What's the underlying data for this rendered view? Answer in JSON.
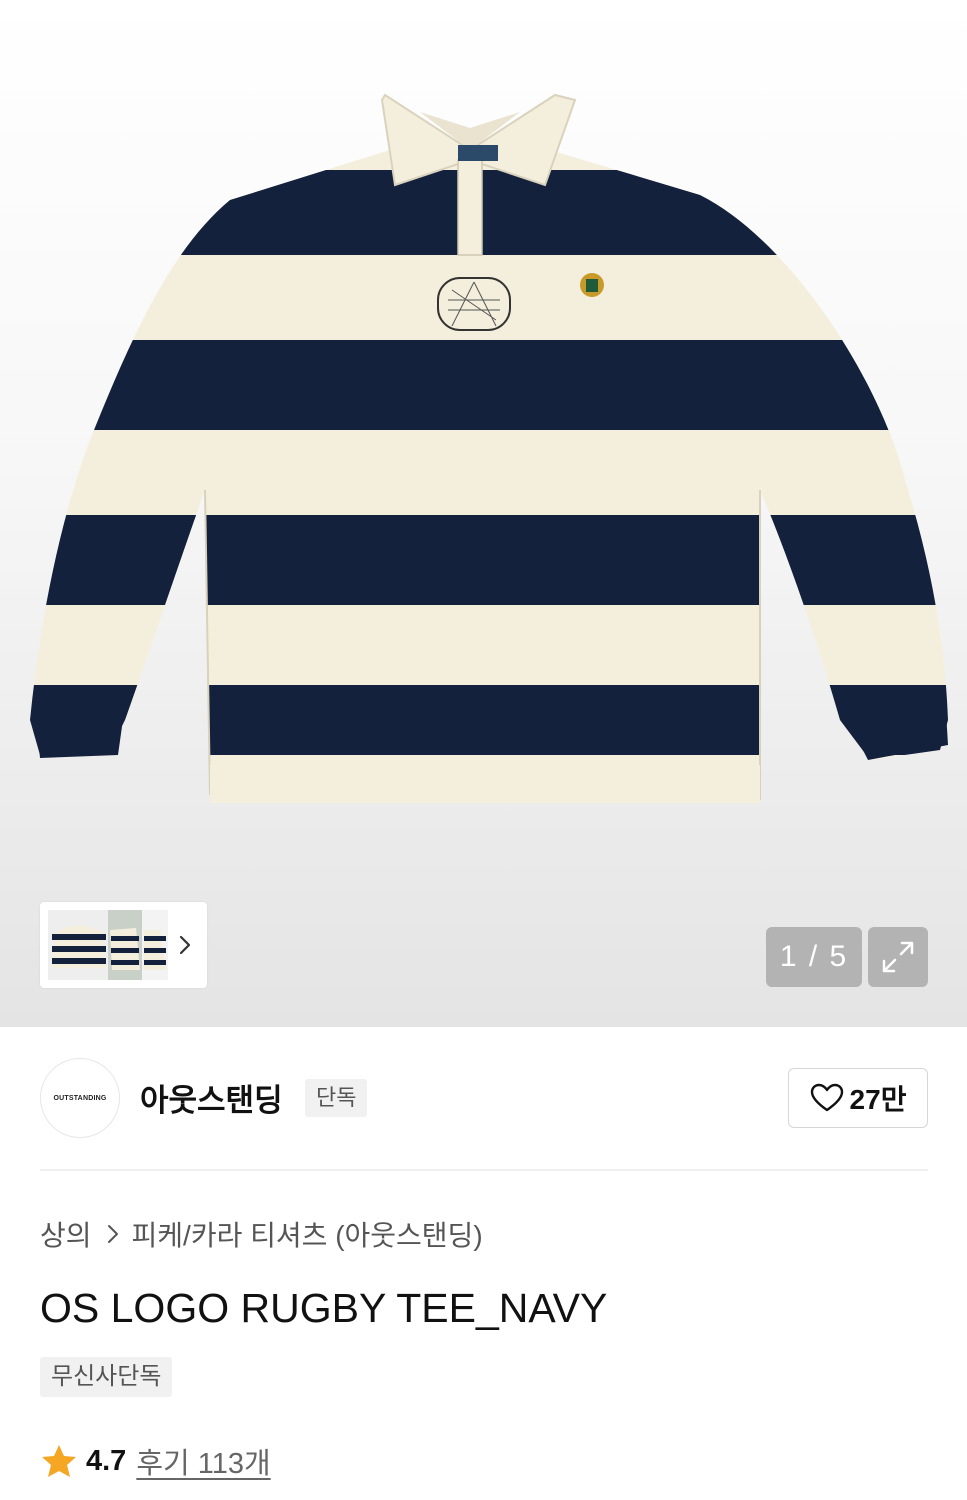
{
  "gallery": {
    "product_image": "striped rugby polo long-sleeve tee, navy and cream stripes",
    "counter_text": "1 / 5",
    "thumb_next_icon": "chevron-right-icon",
    "expand_icon": "expand-icon"
  },
  "brand": {
    "logo_text": "OUTSTANDING",
    "name": "아웃스탠딩",
    "badge": "단독",
    "like_icon": "heart-outline-icon",
    "like_count": "27만"
  },
  "breadcrumb": {
    "category": "상의",
    "subcategory": "피케/카라 티셔츠 (아웃스탠딩)"
  },
  "product": {
    "title": "OS LOGO RUGBY TEE_NAVY",
    "tag": "무신사단독",
    "rating": "4.7",
    "reviews": "후기 113개",
    "star_color": "#f5a623"
  },
  "colors": {
    "navy": "#14213d",
    "cream": "#f4efdc"
  }
}
